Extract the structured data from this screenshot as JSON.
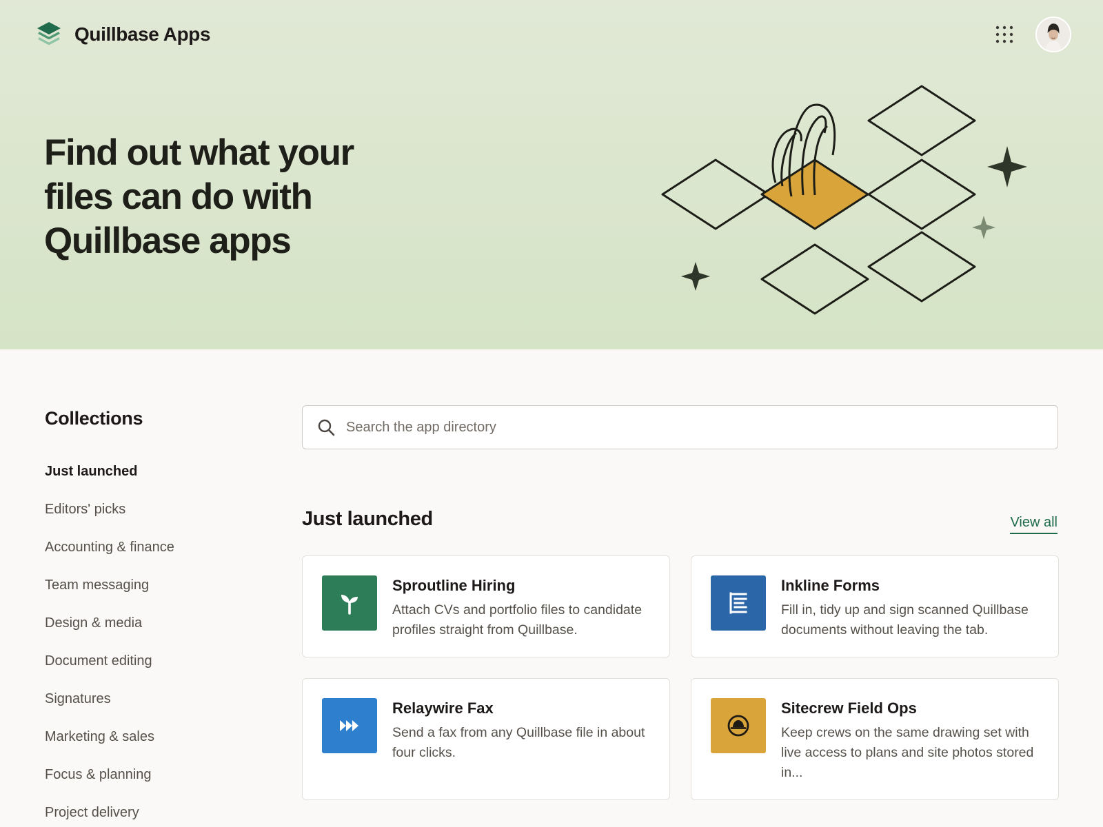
{
  "header": {
    "app_name": "Quillbase Apps",
    "logo_icon": "layers-logo-icon",
    "apps_menu_icon": "grid-dots-icon",
    "avatar_icon": "user-avatar-icon"
  },
  "hero": {
    "title": "Find out what your\nfiles can do with\nQuillbase apps",
    "illustration_icon": "diamond-grid-illustration"
  },
  "sidebar": {
    "title": "Collections",
    "items": [
      {
        "label": "Just launched",
        "active": true
      },
      {
        "label": "Editors' picks",
        "active": false
      },
      {
        "label": "Accounting & finance",
        "active": false
      },
      {
        "label": "Team messaging",
        "active": false
      },
      {
        "label": "Design & media",
        "active": false
      },
      {
        "label": "Document editing",
        "active": false
      },
      {
        "label": "Signatures",
        "active": false
      },
      {
        "label": "Marketing & sales",
        "active": false
      },
      {
        "label": "Focus & planning",
        "active": false
      },
      {
        "label": "Project delivery",
        "active": false
      }
    ]
  },
  "search": {
    "placeholder": "Search the app directory",
    "value": "",
    "icon": "search-icon"
  },
  "section": {
    "title": "Just launched",
    "view_all": "View all"
  },
  "apps": [
    {
      "name": "Sproutline Hiring",
      "description": "Attach CVs and portfolio files to candidate profiles straight from Quillbase.",
      "icon": "sprout-icon",
      "color": "#2e7d59"
    },
    {
      "name": "Inkline Forms",
      "description": "Fill in, tidy up and sign scanned Quillbase documents without leaving the tab.",
      "icon": "form-lines-icon",
      "color": "#2b66a8"
    },
    {
      "name": "Relaywire Fax",
      "description": "Send a fax from any Quillbase file in about four clicks.",
      "icon": "fast-forward-icon",
      "color": "#2f7fcf"
    },
    {
      "name": "Sitecrew Field Ops",
      "description": "Keep crews on the same drawing set with live access to plans and site photos stored in...",
      "icon": "hard-hat-icon",
      "color": "#d9a43a"
    }
  ],
  "colors": {
    "hero_bg": "#dde7d1",
    "accent_green": "#1e6b4c",
    "illustration_gold": "#d9a43a",
    "page_bg": "#faf9f7"
  }
}
